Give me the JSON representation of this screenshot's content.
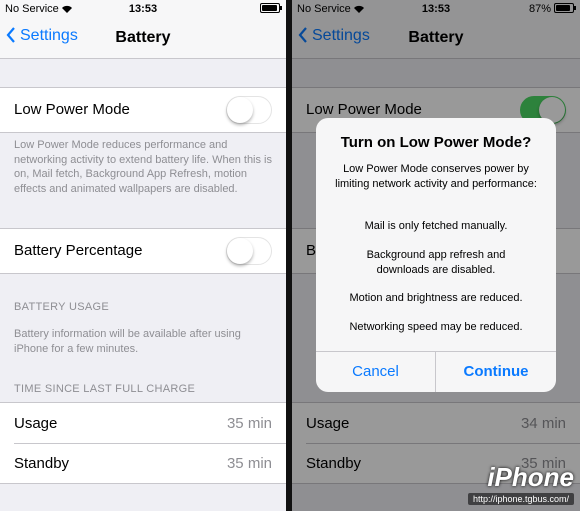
{
  "left": {
    "status": {
      "carrier": "No Service",
      "time": "13:53"
    },
    "nav": {
      "back": "Settings",
      "title": "Battery"
    },
    "low_power": {
      "label": "Low Power Mode",
      "on": false
    },
    "low_power_footer": "Low Power Mode reduces performance and networking activity to extend battery life.  When this is on, Mail fetch, Background App Refresh, motion effects and animated wallpapers are disabled.",
    "battery_pct": {
      "label": "Battery Percentage",
      "on": false
    },
    "usage_header": "BATTERY USAGE",
    "usage_footer": "Battery information will be available after using iPhone for a few minutes.",
    "charge_header": "TIME SINCE LAST FULL CHARGE",
    "usage": {
      "label": "Usage",
      "value": "35 min"
    },
    "standby": {
      "label": "Standby",
      "value": "35 min"
    }
  },
  "right": {
    "status": {
      "carrier": "No Service",
      "time": "13:53",
      "battery": "87%",
      "battery_level": 0.87
    },
    "nav": {
      "back": "Settings",
      "title": "Battery"
    },
    "low_power": {
      "label": "Low Power Mode",
      "on": true
    },
    "battery_pct_partial": "B",
    "usage": {
      "label": "Usage",
      "value": "34 min"
    },
    "standby": {
      "label": "Standby",
      "value": "35 min"
    },
    "alert": {
      "title": "Turn on Low Power Mode?",
      "message": "Low Power Mode conserves power by limiting network activity and performance:",
      "items": [
        "Mail is only fetched manually.",
        "Background app refresh and downloads are disabled.",
        "Motion and brightness are reduced.",
        "Networking speed may be reduced."
      ],
      "cancel": "Cancel",
      "continue": "Continue"
    }
  },
  "watermark": {
    "logo": "iPhone",
    "url": "http://iphone.tgbus.com/"
  },
  "colors": {
    "accent": "#0a7aff",
    "switch_on": "#4cd964",
    "background": "#efeff4"
  }
}
